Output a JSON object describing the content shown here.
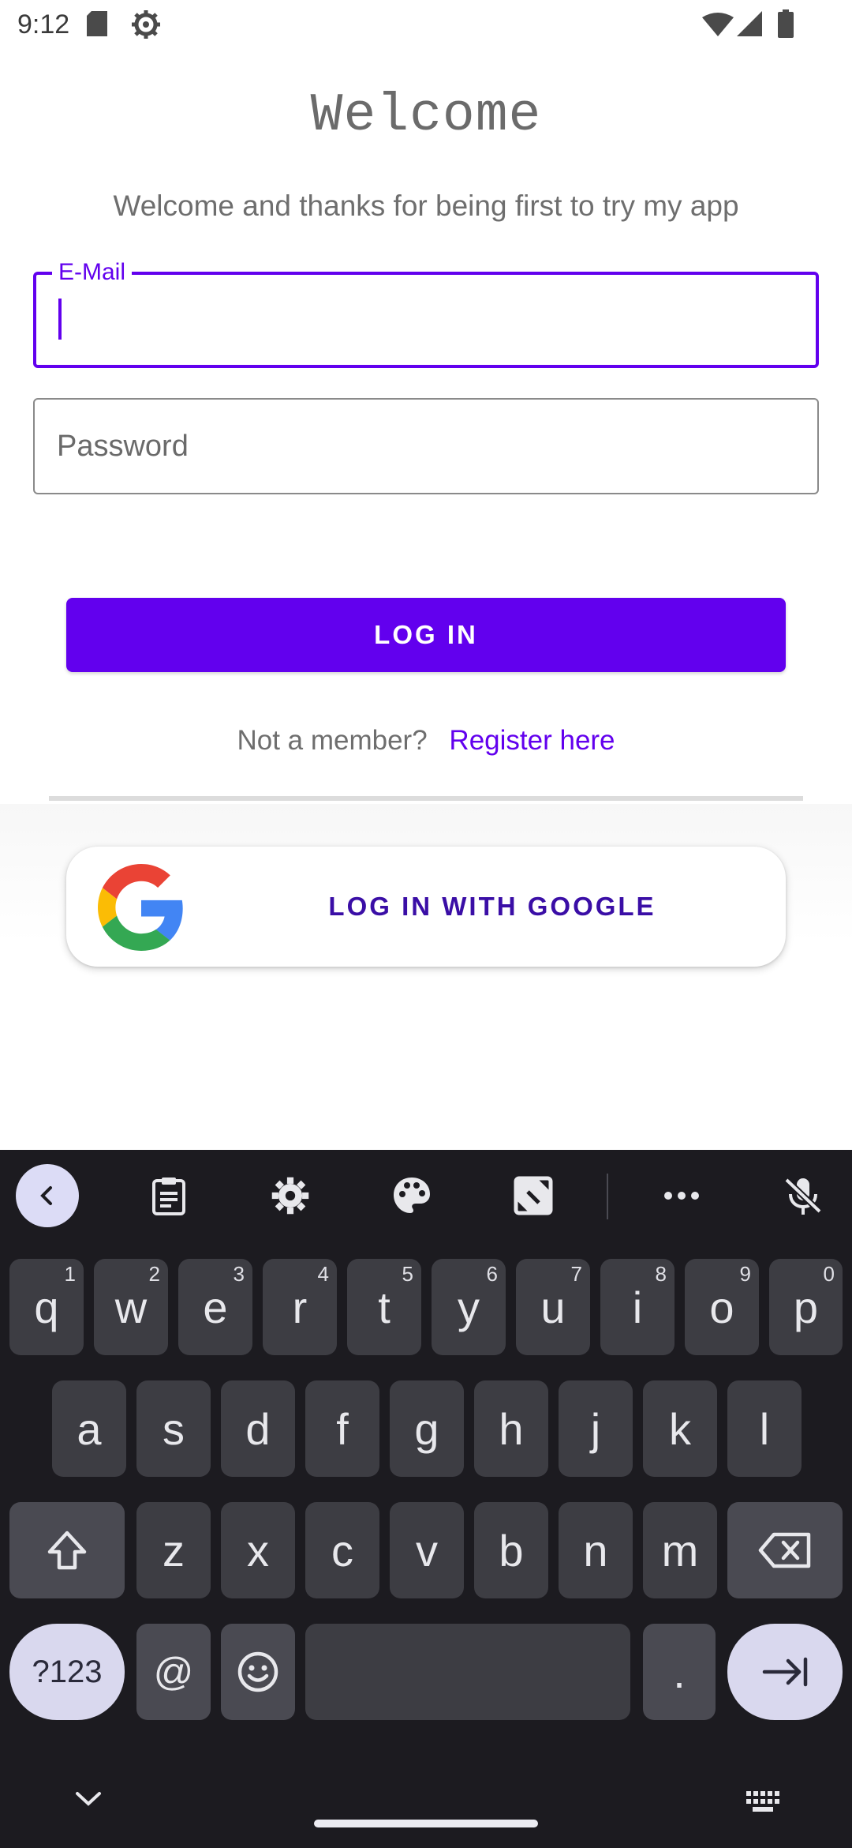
{
  "status_bar": {
    "time": "9:12",
    "icons": [
      "sd-card-icon",
      "settings-gear-icon",
      "wifi-icon",
      "signal-icon",
      "battery-icon"
    ]
  },
  "screen": {
    "title": "Welcome",
    "subtitle": "Welcome and thanks for being first to try my app",
    "email_field": {
      "label": "E-Mail",
      "value": ""
    },
    "password_field": {
      "placeholder": "Password",
      "value": ""
    },
    "login_button": "LOG IN",
    "register_prompt": "Not a member?",
    "register_link": "Register here",
    "google_button": "LOG IN WITH GOOGLE"
  },
  "keyboard": {
    "toolbar": [
      "back-icon",
      "clipboard-icon",
      "settings-icon",
      "palette-icon",
      "one-handed-icon",
      "more-icon",
      "mic-off-icon"
    ],
    "row1": [
      {
        "k": "q",
        "h": "1"
      },
      {
        "k": "w",
        "h": "2"
      },
      {
        "k": "e",
        "h": "3"
      },
      {
        "k": "r",
        "h": "4"
      },
      {
        "k": "t",
        "h": "5"
      },
      {
        "k": "y",
        "h": "6"
      },
      {
        "k": "u",
        "h": "7"
      },
      {
        "k": "i",
        "h": "8"
      },
      {
        "k": "o",
        "h": "9"
      },
      {
        "k": "p",
        "h": "0"
      }
    ],
    "row2": [
      "a",
      "s",
      "d",
      "f",
      "g",
      "h",
      "j",
      "k",
      "l"
    ],
    "row3": [
      "z",
      "x",
      "c",
      "v",
      "b",
      "n",
      "m"
    ],
    "row4": {
      "symbols": "?123",
      "at": "@",
      "period": "."
    }
  },
  "colors": {
    "accent": "#6200ee",
    "google_text": "#3a0ea6",
    "keyboard_bg": "#1c1b20",
    "key_bg": "#3d3d43"
  }
}
